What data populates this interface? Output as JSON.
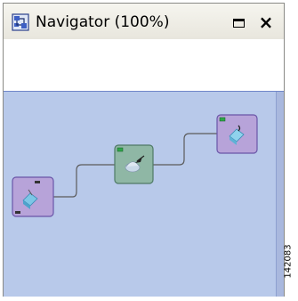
{
  "window": {
    "title": "Navigator (100%)",
    "close_glyph": "×"
  },
  "figure_id": "142083",
  "icons": {
    "navigator": "navigator-icon",
    "maximize": "maximize-icon",
    "close": "close-icon"
  },
  "colors": {
    "canvas_bg": "#b8c9ea",
    "node_purple": "#b7a3d9",
    "node_green": "#8fb7a5",
    "connector": "#5b5b5b"
  }
}
